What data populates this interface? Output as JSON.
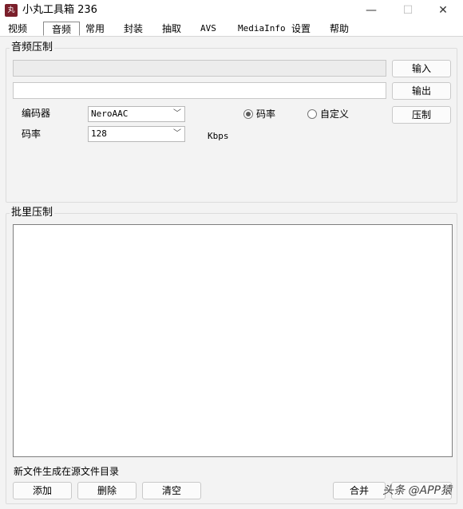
{
  "window": {
    "icon_text": "丸",
    "title": "小丸工具箱 236",
    "minimize": "—",
    "maximize": "☐",
    "close": "✕"
  },
  "tabs": [
    "视频",
    "音频",
    "常用",
    "封装",
    "抽取",
    "AVS",
    "MediaInfo",
    "设置",
    "帮助"
  ],
  "selected_tab": "音频",
  "audio": {
    "group_title": "音频压制",
    "input_button": "输入",
    "output_button": "输出",
    "input_value": "",
    "output_value": "",
    "encoder_label": "编码器",
    "encoder_value": "NeroAAC",
    "bitrate_label": "码率",
    "bitrate_value": "128",
    "bitrate_unit": "Kbps",
    "mode_bitrate": "码率",
    "mode_custom": "自定义",
    "encode_button": "压制"
  },
  "batch": {
    "group_title": "批里压制",
    "note": "新文件生成在源文件目录",
    "add_button": "添加",
    "delete_button": "删除",
    "clear_button": "清空",
    "merge_button": "合并"
  },
  "watermark": "头条 @APP猿"
}
